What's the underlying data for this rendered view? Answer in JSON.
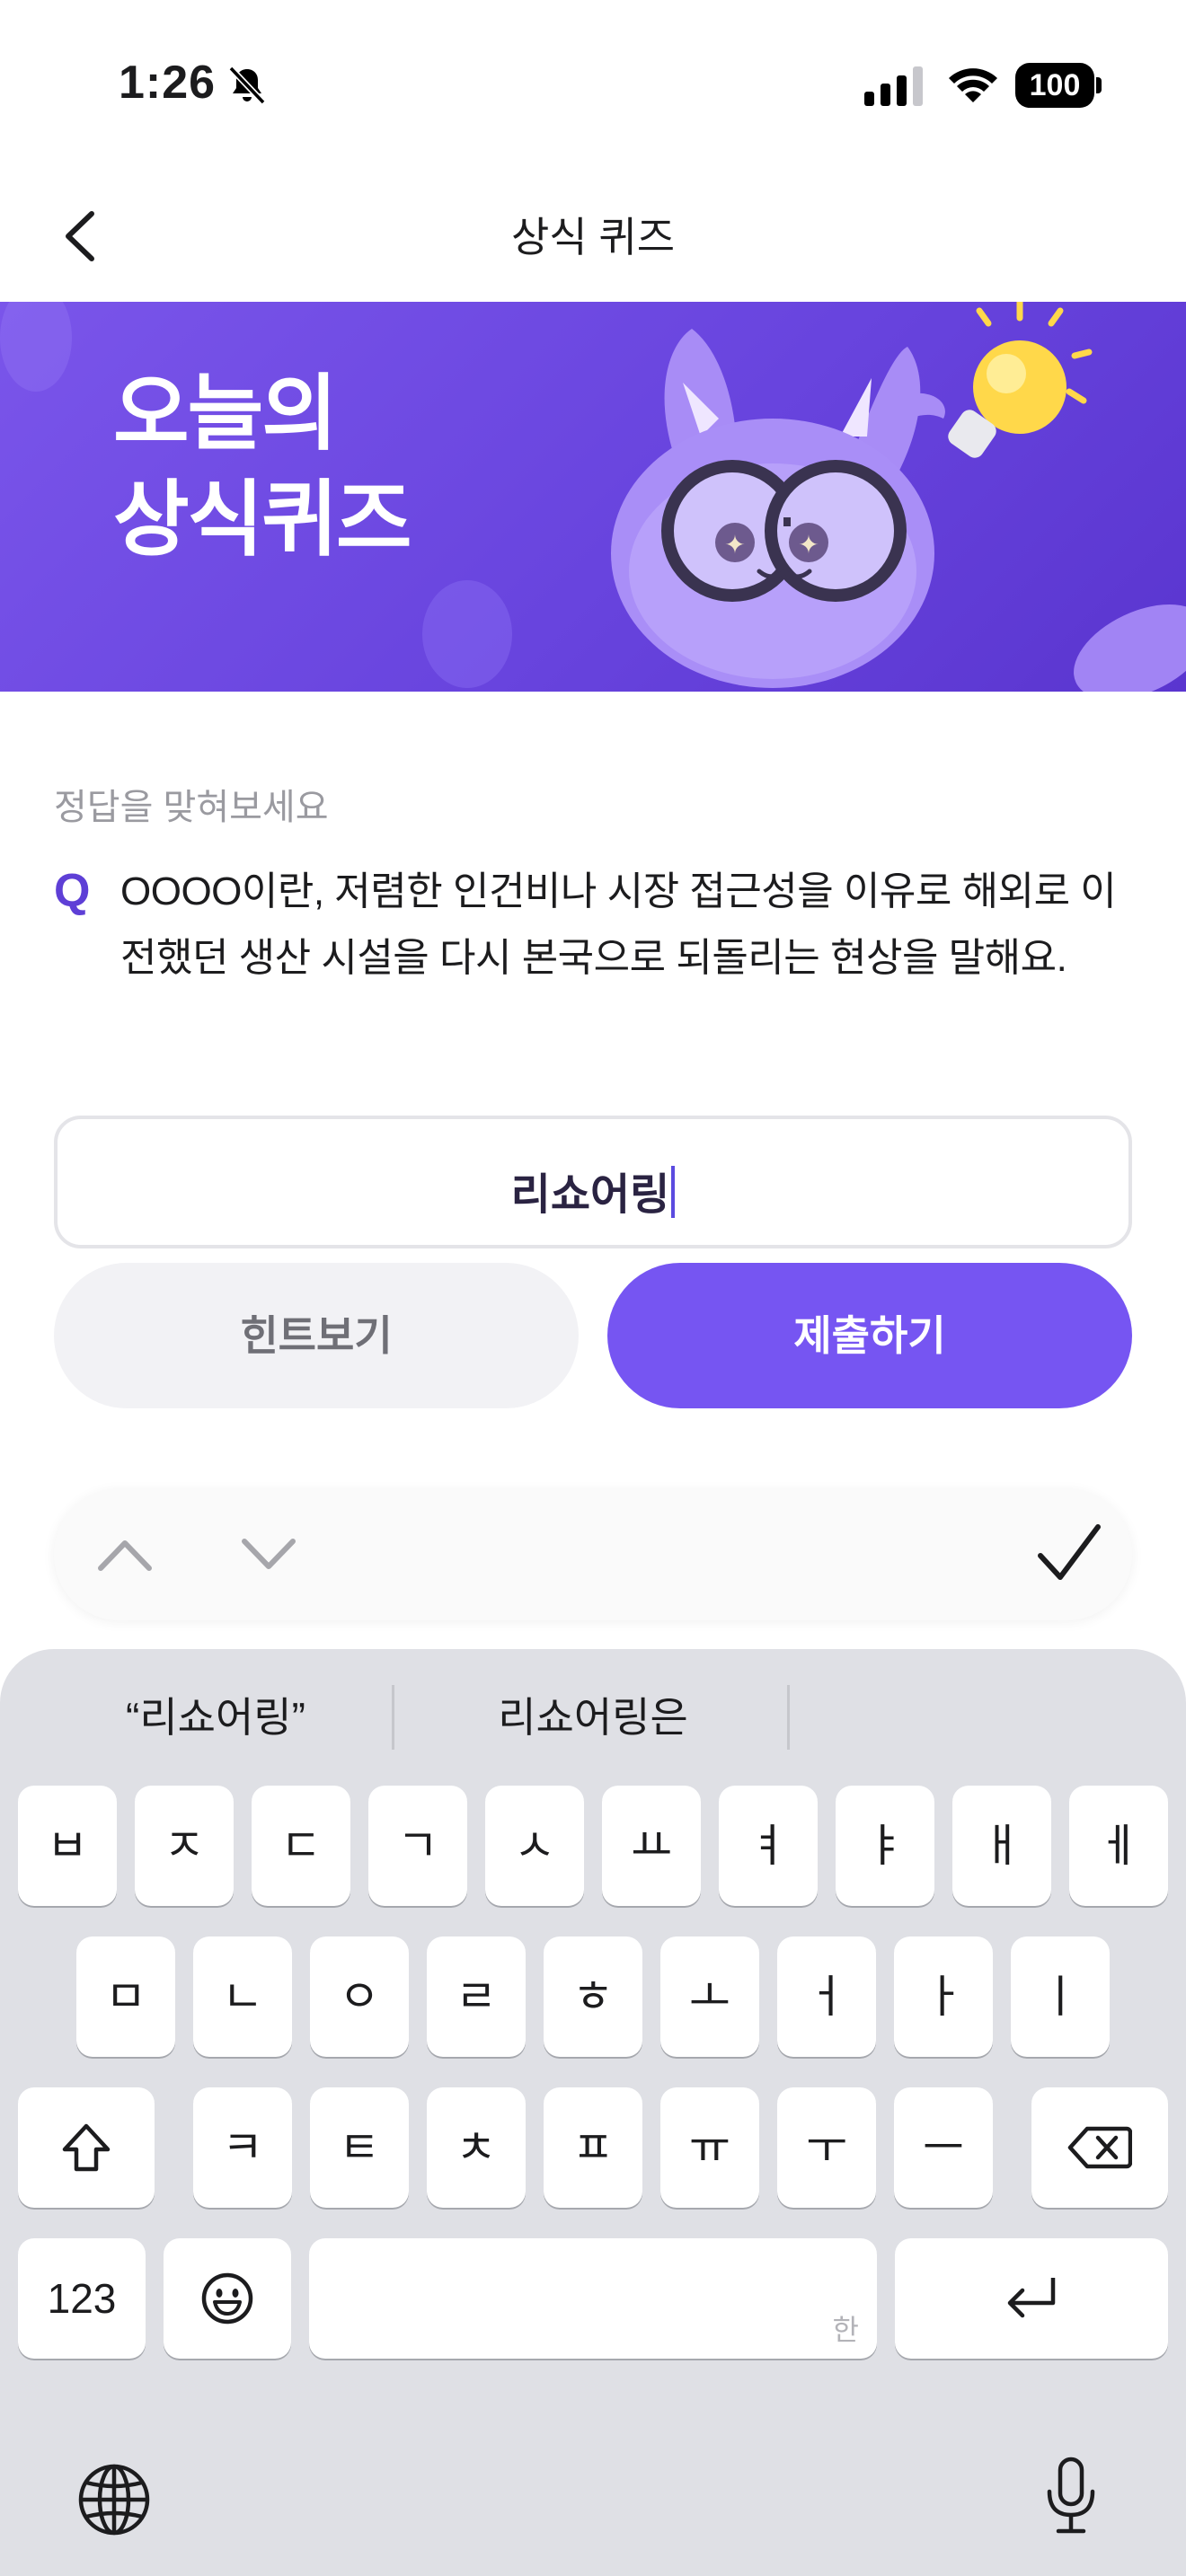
{
  "status": {
    "time": "1:26",
    "battery": "100",
    "icons": [
      "bell-slash-icon",
      "signal-icon",
      "wifi-icon",
      "battery-icon"
    ]
  },
  "nav": {
    "title": "상식 퀴즈",
    "back_icon": "chevron-left-icon"
  },
  "banner": {
    "title_line1": "오늘의",
    "title_line2": "상식퀴즈",
    "bg_color": "#6b48e0"
  },
  "quiz": {
    "prompt": "정답을 맞혀보세요",
    "q_label": "Q",
    "question": "OOOO이란, 저렴한 인건비나 시장 접근성을 이유로 해외로 이전했던 생산 시설을 다시 본국으로 되돌리는 현상을 말해요.",
    "answer_value": "리쇼어링"
  },
  "buttons": {
    "hint": "힌트보기",
    "submit": "제출하기",
    "accent_color": "#7655f2"
  },
  "accessory": {
    "icons": [
      "chevron-up-icon",
      "chevron-down-icon",
      "checkmark-icon"
    ]
  },
  "keyboard": {
    "suggestions": [
      "“리쇼어링”",
      "리쇼어링은"
    ],
    "row1": [
      "ㅂ",
      "ㅈ",
      "ㄷ",
      "ㄱ",
      "ㅅ",
      "ㅛ",
      "ㅕ",
      "ㅑ",
      "ㅐ",
      "ㅔ"
    ],
    "row2": [
      "ㅁ",
      "ㄴ",
      "ㅇ",
      "ㄹ",
      "ㅎ",
      "ㅗ",
      "ㅓ",
      "ㅏ",
      "ㅣ"
    ],
    "row3": [
      "ㅋ",
      "ㅌ",
      "ㅊ",
      "ㅍ",
      "ㅠ",
      "ㅜ",
      "ㅡ"
    ],
    "numbers_key": "123",
    "space_hint": "한",
    "icons": [
      "shift-icon",
      "backspace-icon",
      "emoji-icon",
      "return-icon",
      "globe-icon",
      "microphone-icon"
    ]
  }
}
